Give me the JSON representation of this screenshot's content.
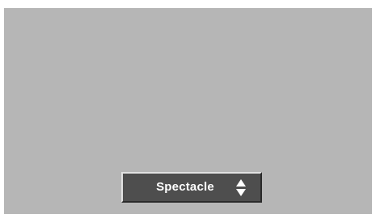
{
  "selector": {
    "value": "Spectacle",
    "up_icon": "triangle-up-icon",
    "down_icon": "triangle-down-icon"
  },
  "colors": {
    "screen_background": "#b6b6b6",
    "selector_background": "#4e4e4e",
    "selector_text": "#ffffff"
  }
}
